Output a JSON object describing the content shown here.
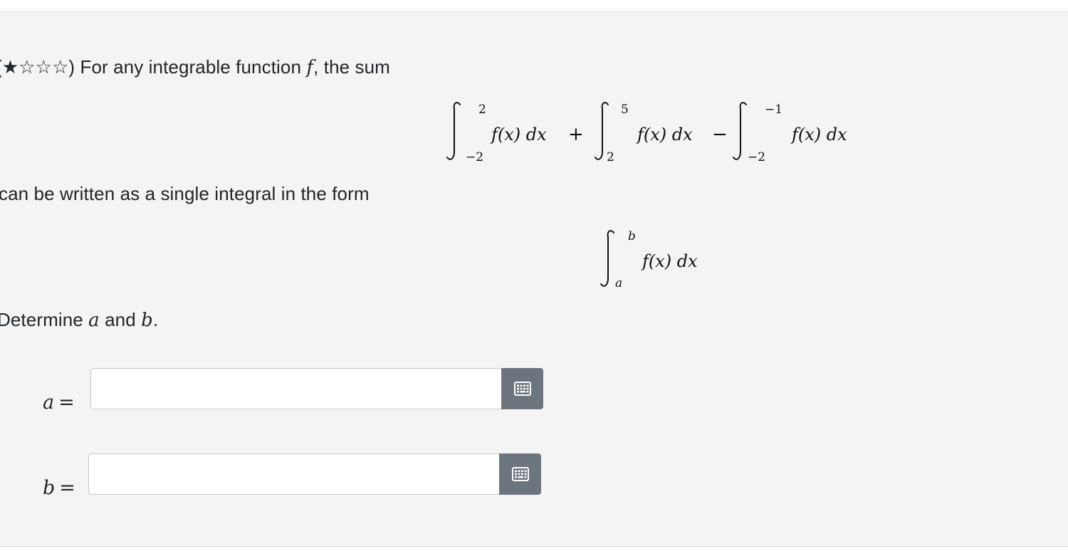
{
  "question": {
    "stars": "(★☆☆☆)",
    "intro_before_f": " For any integrable function ",
    "var_f": "f",
    "intro_after_f": ", the sum",
    "sum_expression": {
      "term1_lower": "−2",
      "term1_upper": "2",
      "term2_lower": "2",
      "term2_upper": "5",
      "term3_lower": "−2",
      "term3_upper": "−1",
      "integrand": "f(x) dx",
      "op_plus": "+",
      "op_minus": "−"
    },
    "middle_text": "can be written as a single integral in the form",
    "single_integral": {
      "lower": "a",
      "upper": "b",
      "integrand": "f(x) dx"
    },
    "determine_prefix": "Determine ",
    "var_a": "a",
    "and_word": " and ",
    "var_b": "b",
    "period": "."
  },
  "answers": [
    {
      "label": "a",
      "equals": "=",
      "value": "",
      "placeholder": "",
      "keyboard_icon": "keyboard-icon"
    },
    {
      "label": "b",
      "equals": "=",
      "value": "",
      "placeholder": "",
      "keyboard_icon": "keyboard-icon"
    }
  ],
  "colors": {
    "panel_background": "#f4f4f4",
    "keyboard_button": "#6c757d",
    "text": "#212529"
  }
}
